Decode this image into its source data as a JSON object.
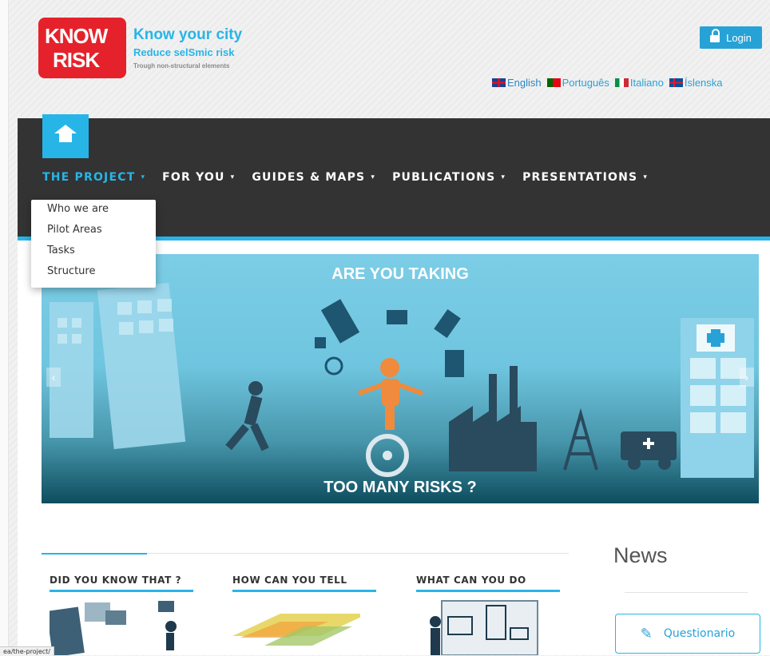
{
  "header": {
    "logo": {
      "line1": "KNOW",
      "line2": "RISK"
    },
    "tagline_main": "Know your city",
    "tagline_sub": "Reduce selSmic risk",
    "tagline_small": "Trough non-structural elements",
    "login_label": "Login"
  },
  "languages": [
    {
      "label": "English",
      "flag": "uk-flag"
    },
    {
      "label": "Português",
      "flag": "pt-flag"
    },
    {
      "label": "Italiano",
      "flag": "it-flag"
    },
    {
      "label": "Íslenska",
      "flag": "is-flag"
    }
  ],
  "nav": {
    "items": [
      {
        "label": "THE PROJECT",
        "active": true
      },
      {
        "label": "FOR YOU"
      },
      {
        "label": "GUIDES & MAPS"
      },
      {
        "label": "PUBLICATIONS"
      },
      {
        "label": "PRESENTATIONS"
      }
    ],
    "caret": "▾",
    "dropdown": [
      "Who we are",
      "Pilot Areas",
      "Tasks",
      "Structure"
    ]
  },
  "hero": {
    "title": "ARE YOU TAKING",
    "subtitle": "TOO MANY RISKS ?",
    "prev": "‹",
    "next": "›"
  },
  "columns": [
    {
      "title": "DID YOU KNOW THAT ?"
    },
    {
      "title": "HOW CAN YOU TELL"
    },
    {
      "title": "WHAT CAN YOU DO"
    }
  ],
  "news": {
    "title": "News",
    "questionnaire_label": "Questionario"
  },
  "status_bar": {
    "url": "ea/the-project/"
  },
  "colors": {
    "accent": "#27b5e8",
    "nav_bg": "#333333",
    "logo_red": "#e5222b"
  }
}
